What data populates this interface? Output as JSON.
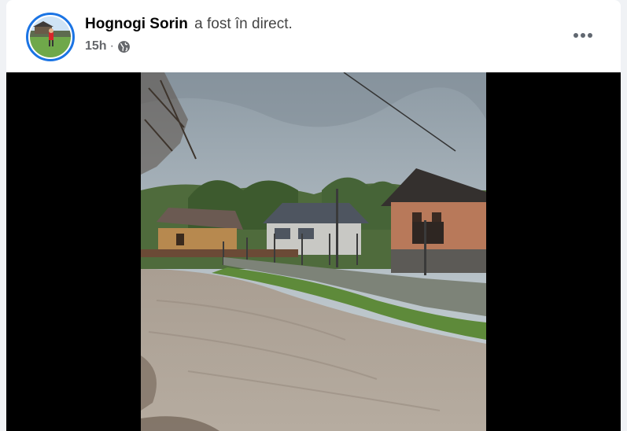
{
  "post": {
    "author": {
      "name": "Hognogi Sorin",
      "action_text": "a fost în direct."
    },
    "timestamp": "15h",
    "separator": "·",
    "audience_icon": "globe-icon",
    "more_options_icon": "more-horizontal-icon"
  },
  "video": {
    "scene": "flooded-village-street",
    "content_icon": "live-video"
  },
  "colors": {
    "avatar_ring": "#1b74e4",
    "page_background": "#f0f2f5",
    "video_letterbox": "#000000"
  }
}
